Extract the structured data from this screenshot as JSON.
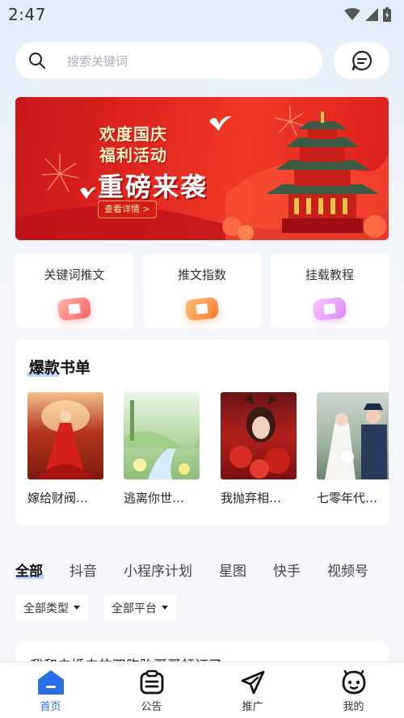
{
  "status_bar": {
    "time": "2:47"
  },
  "search": {
    "placeholder": "搜索关键词",
    "icon": "search-icon",
    "message_icon": "message-icon"
  },
  "banner": {
    "line1": "欢度国庆",
    "line2": "福利活动",
    "line3": "重磅来袭",
    "button_label": "查看详情 >"
  },
  "quick_links": [
    {
      "label": "关键词推文",
      "icon": "pink-card-icon",
      "color": "#ff6f6f"
    },
    {
      "label": "推文指数",
      "icon": "orange-card-icon",
      "color": "#ff8a3d"
    },
    {
      "label": "挂载教程",
      "icon": "purple-card-icon",
      "color": "#d58af0"
    }
  ],
  "hot_books": {
    "title": "爆款书单",
    "items": [
      {
        "name": "嫁给财阀…"
      },
      {
        "name": "逃离你世…"
      },
      {
        "name": "我抛弃相…"
      },
      {
        "name": "七零年代…"
      }
    ]
  },
  "tabs": [
    {
      "label": "全部",
      "active": true
    },
    {
      "label": "抖音"
    },
    {
      "label": "小程序计划"
    },
    {
      "label": "星图"
    },
    {
      "label": "快手"
    },
    {
      "label": "视频号"
    }
  ],
  "filters": {
    "type": "全部类型",
    "platform": "全部平台"
  },
  "list_preview": {
    "title": "我和未婚夫的双胞胎哥哥领证了"
  },
  "bottom_nav": [
    {
      "label": "首页",
      "icon": "home-icon",
      "active": true
    },
    {
      "label": "公告",
      "icon": "notice-icon"
    },
    {
      "label": "推广",
      "icon": "paper-plane-icon"
    },
    {
      "label": "我的",
      "icon": "profile-face-icon"
    }
  ],
  "colors": {
    "accent": "#2b6fe8",
    "banner_red": "#e0271f"
  }
}
